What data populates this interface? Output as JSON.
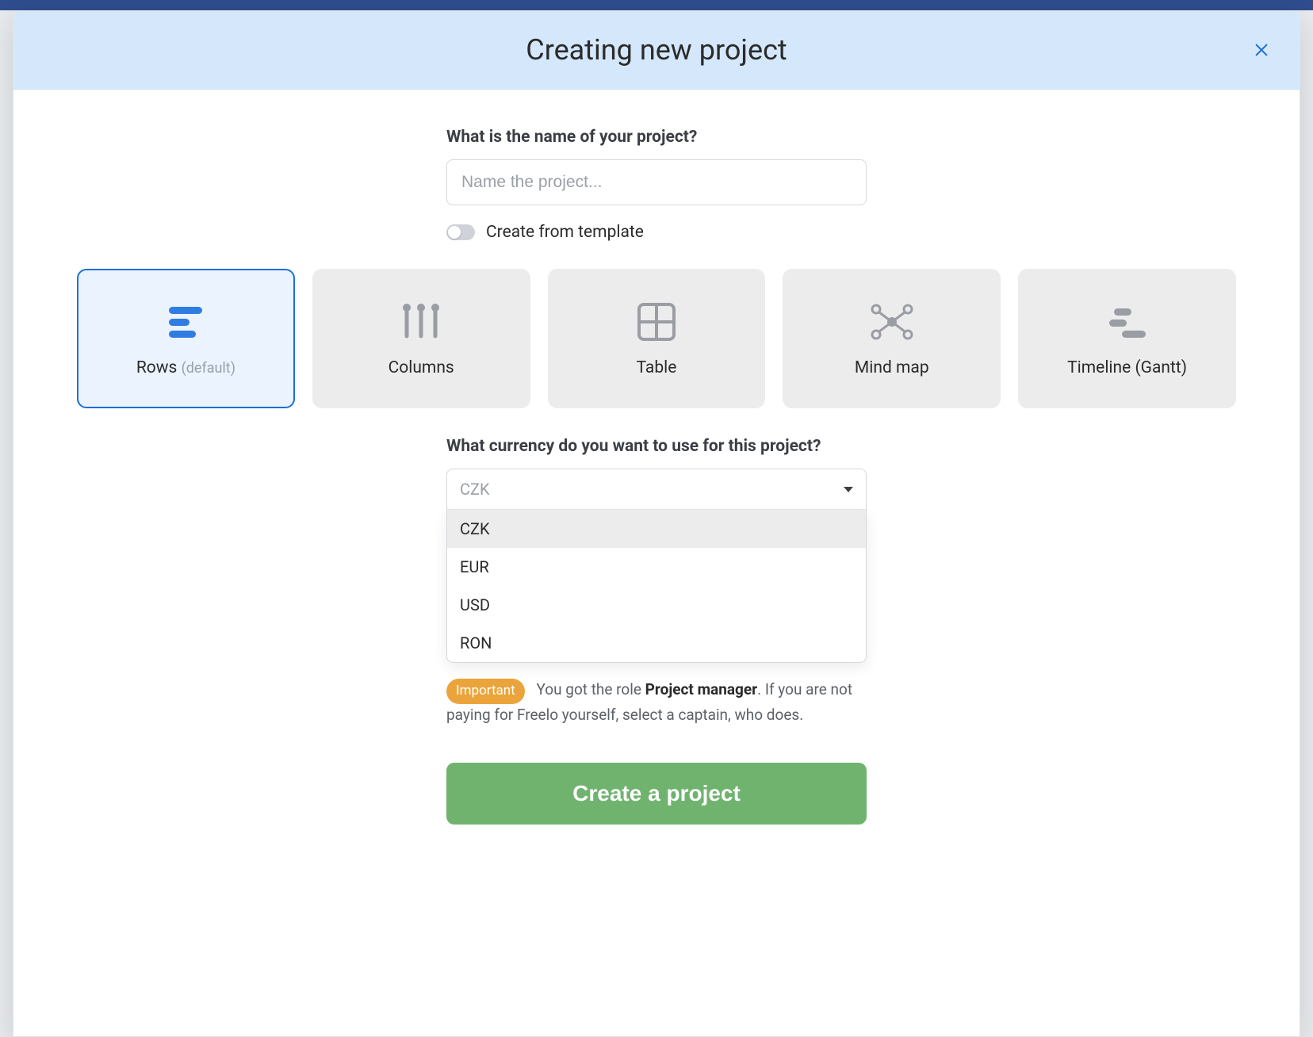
{
  "modal": {
    "title": "Creating new project"
  },
  "name_question": "What is the name of your project?",
  "name_placeholder": "Name the project...",
  "template_toggle_label": "Create from template",
  "views": [
    {
      "label": "Rows",
      "suffix": "(default)",
      "selected": true
    },
    {
      "label": "Columns",
      "selected": false
    },
    {
      "label": "Table",
      "selected": false
    },
    {
      "label": "Mind map",
      "selected": false
    },
    {
      "label": "Timeline (Gantt)",
      "selected": false
    }
  ],
  "currency_question": "What currency do you want to use for this project?",
  "currency_selected": "CZK",
  "currency_options": [
    "CZK",
    "EUR",
    "USD",
    "RON"
  ],
  "note": {
    "badge": "Important",
    "text_before": "You got the role ",
    "role": "Project manager",
    "text_after": ". If you are not paying for Freelo yourself, select a captain, who does."
  },
  "submit_label": "Create a project"
}
